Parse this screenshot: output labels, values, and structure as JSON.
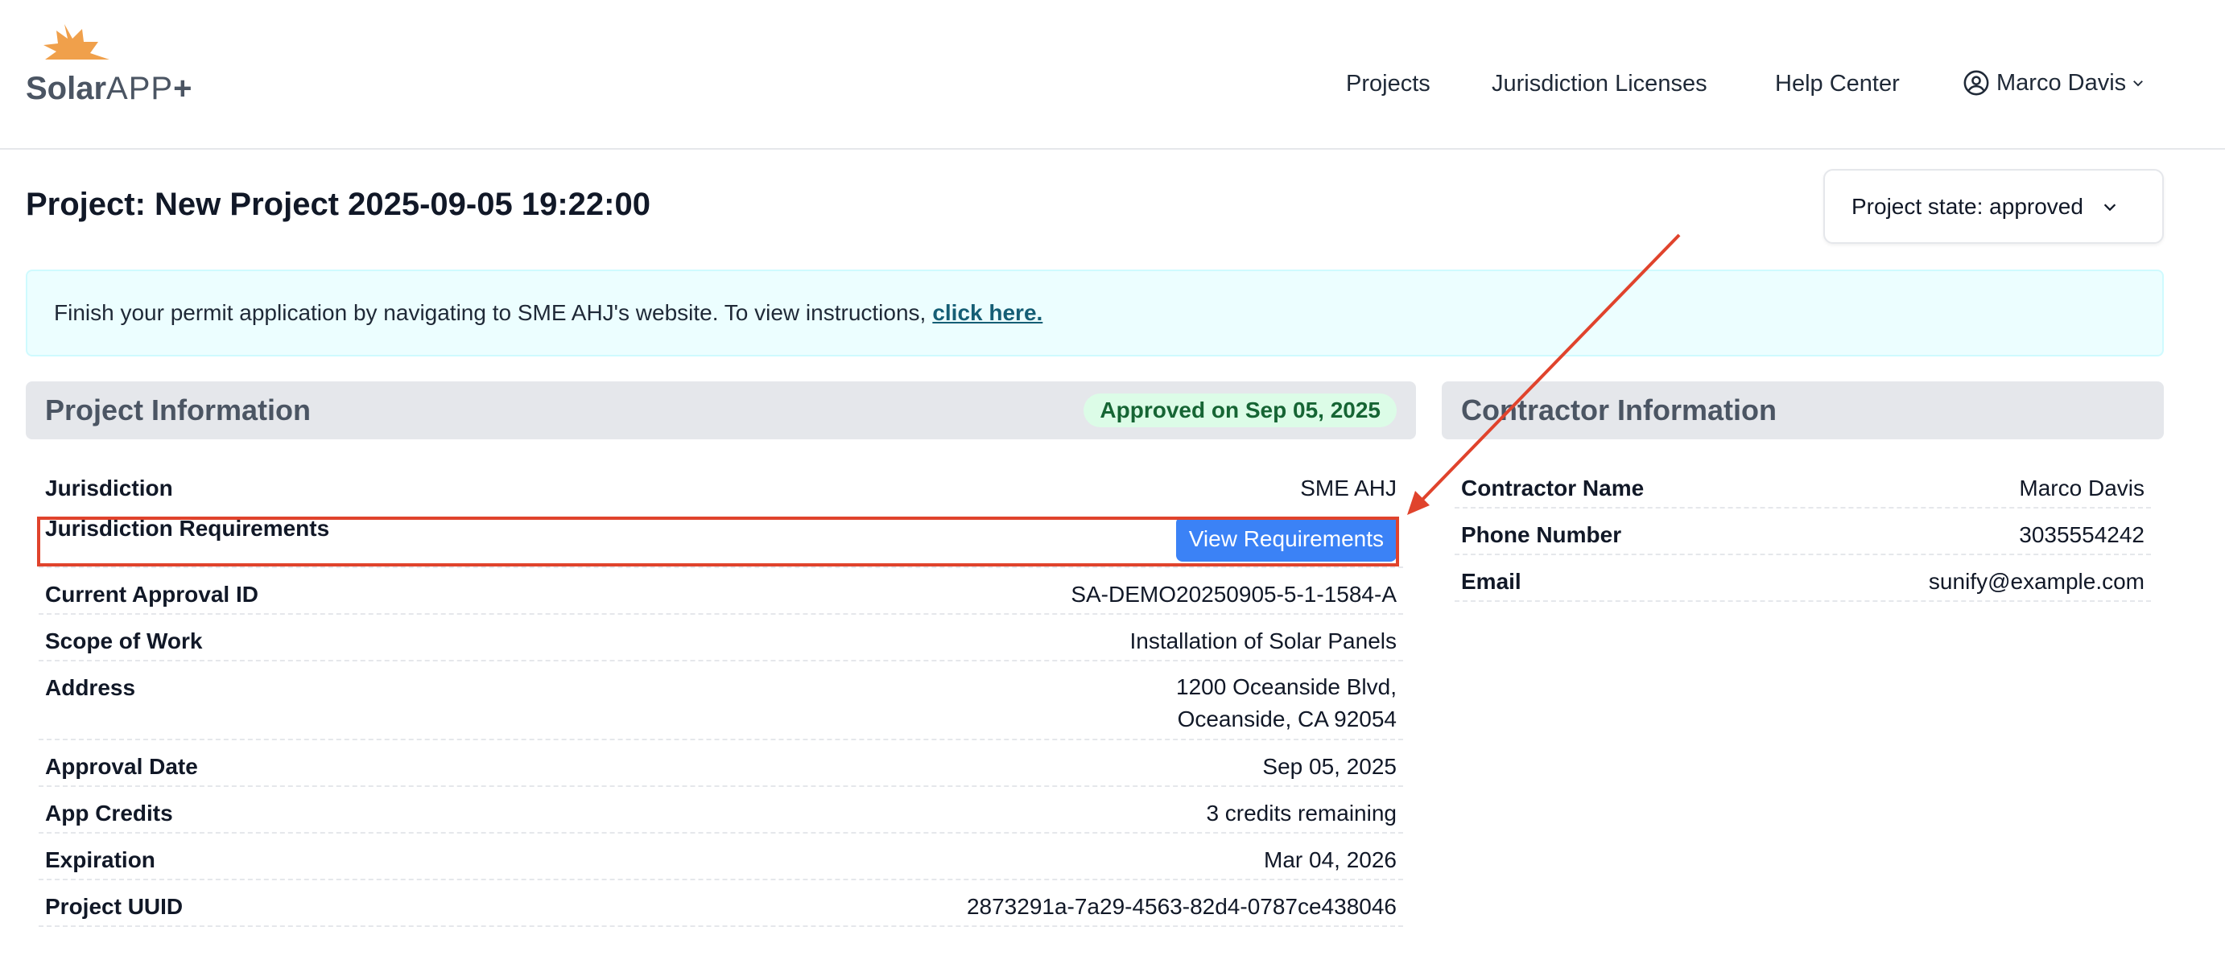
{
  "header": {
    "logo": {
      "brand": "Solar",
      "product": "APP",
      "plus": "+"
    },
    "nav": {
      "projects": "Projects",
      "licenses": "Jurisdiction Licenses",
      "help": "Help Center",
      "user": "Marco Davis"
    }
  },
  "page": {
    "title": "Project: New Project 2025-09-05 19:22:00",
    "state_button": "Project state: approved"
  },
  "banner": {
    "text": "Finish your permit application by navigating to SME AHJ's website. To view instructions,",
    "link": "click here."
  },
  "project_info": {
    "heading": "Project Information",
    "badge": "Approved on Sep 05, 2025",
    "rows": [
      {
        "label": "Jurisdiction",
        "value": "SME AHJ"
      },
      {
        "label": "Jurisdiction Requirements",
        "button": "View Requirements"
      },
      {
        "label": "Current Approval ID",
        "value": "SA-DEMO20250905-5-1-1584-A"
      },
      {
        "label": "Scope of Work",
        "value": "Installation of Solar Panels"
      },
      {
        "label": "Address",
        "value_line1": "1200 Oceanside Blvd,",
        "value_line2": "Oceanside, CA 92054"
      },
      {
        "label": "Approval Date",
        "value": "Sep 05, 2025"
      },
      {
        "label": "App Credits",
        "value": "3 credits remaining"
      },
      {
        "label": "Expiration",
        "value": "Mar 04, 2026"
      },
      {
        "label": "Project UUID",
        "value": "2873291a-7a29-4563-82d4-0787ce438046"
      }
    ]
  },
  "contractor_info": {
    "heading": "Contractor Information",
    "rows": [
      {
        "label": "Contractor Name",
        "value": "Marco Davis"
      },
      {
        "label": "Phone Number",
        "value": "3035554242"
      },
      {
        "label": "Email",
        "value": "sunify@example.com"
      }
    ]
  },
  "colors": {
    "logo_sun": "#f0a04b",
    "primary_button": "#3b82f6",
    "annotation": "#e0432c",
    "banner_bg": "#ecfeff",
    "badge_bg": "#dcfce7"
  }
}
